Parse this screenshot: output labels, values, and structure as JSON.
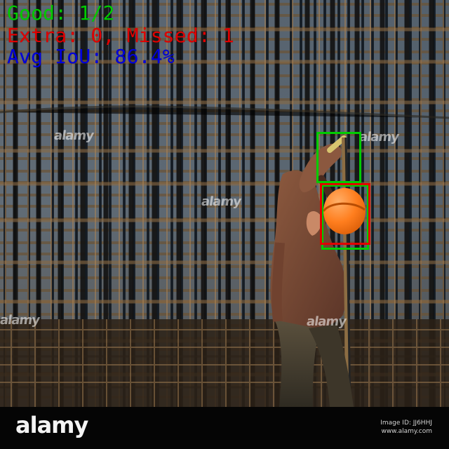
{
  "overlay": {
    "good": "Good: 1/2",
    "missed": "Extra: 0, Missed: 1",
    "iou": "Avg IoU: 86.4%"
  },
  "watermark": {
    "logo": "alamy",
    "stock_id": "Image ID: JJ6HHJ",
    "stock_url": "www.alamy.com",
    "repeated": [
      "alamy",
      "alamy",
      "alamy",
      "alamy",
      "alamy"
    ]
  },
  "colors": {
    "good": "#00cc00",
    "missed": "#e00000",
    "iou": "#0000dd",
    "background": "#18212d",
    "rebar": "#6b5234",
    "worker": "#7a4d34",
    "helmet": "#ff7c1a"
  }
}
